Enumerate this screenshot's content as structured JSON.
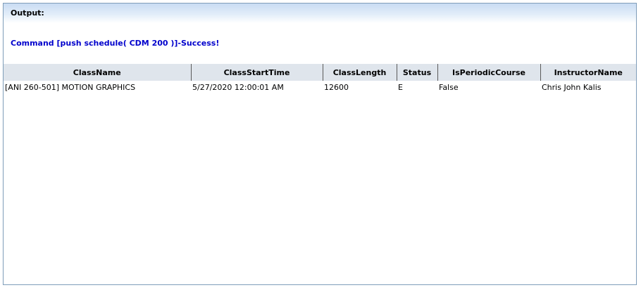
{
  "header": {
    "title": "Output:"
  },
  "message": "Command [push schedule( CDM 200 )]-Success!",
  "table": {
    "columns": [
      "ClassName",
      "ClassStartTime",
      "ClassLength",
      "Status",
      "IsPeriodicCourse",
      "InstructorName"
    ],
    "rows": [
      [
        "[ANI 260-501] MOTION GRAPHICS",
        "5/27/2020 12:00:01 AM",
        "12600",
        "E",
        "False",
        "Chris John Kalis"
      ]
    ]
  }
}
